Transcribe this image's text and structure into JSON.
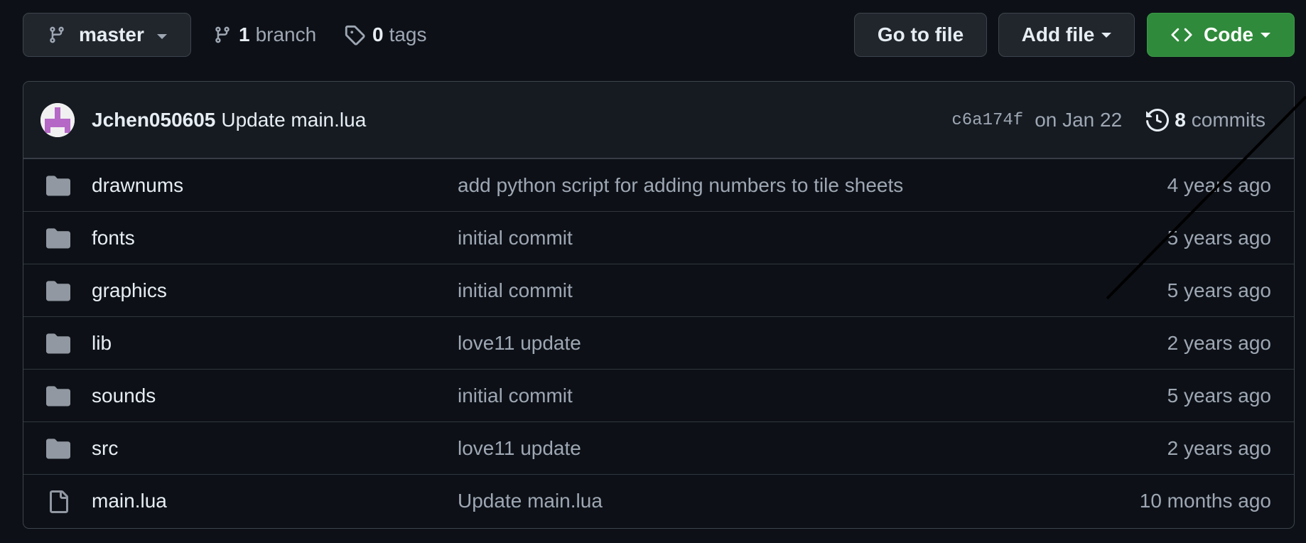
{
  "toolbar": {
    "branch_name": "master",
    "branch_count": "1",
    "branch_word": "branch",
    "tag_count": "0",
    "tag_word": "tags",
    "goto_file_label": "Go to file",
    "add_file_label": "Add file",
    "code_label": "Code"
  },
  "latest_commit": {
    "author": "Jchen050605",
    "message": "Update main.lua",
    "sha": "c6a174f",
    "date": "on Jan 22",
    "commit_count": "8",
    "commit_word": "commits"
  },
  "files": [
    {
      "type": "folder",
      "name": "drawnums",
      "message": "add python script for adding numbers to tile sheets",
      "age": "4 years ago"
    },
    {
      "type": "folder",
      "name": "fonts",
      "message": "initial commit",
      "age": "5 years ago"
    },
    {
      "type": "folder",
      "name": "graphics",
      "message": "initial commit",
      "age": "5 years ago"
    },
    {
      "type": "folder",
      "name": "lib",
      "message": "love11 update",
      "age": "2 years ago"
    },
    {
      "type": "folder",
      "name": "sounds",
      "message": "initial commit",
      "age": "5 years ago"
    },
    {
      "type": "folder",
      "name": "src",
      "message": "love11 update",
      "age": "2 years ago"
    },
    {
      "type": "file",
      "name": "main.lua",
      "message": "Update main.lua",
      "age": "10 months ago"
    }
  ],
  "colors": {
    "background": "#0d1117",
    "code_button": "#2f8a3b",
    "muted_text": "#9ea7b3",
    "folder_icon": "#9198a1"
  }
}
